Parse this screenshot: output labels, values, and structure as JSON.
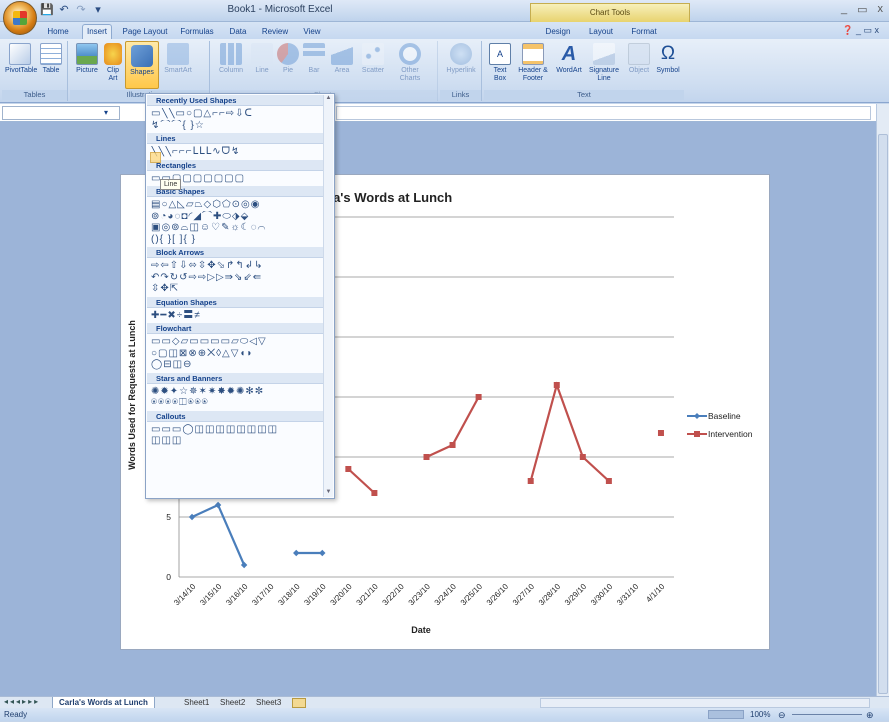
{
  "window": {
    "title": "Book1 - Microsoft Excel",
    "context_tab_header": "Chart Tools",
    "controls": [
      "_",
      "▭",
      "x"
    ]
  },
  "tabs": [
    "Home",
    "Insert",
    "Page Layout",
    "Formulas",
    "Data",
    "Review",
    "View",
    "Design",
    "Layout",
    "Format"
  ],
  "active_tab": "Insert",
  "ribbon": {
    "groups": {
      "tables": "Tables",
      "illustrations": "Illustrati",
      "charts": "Charts",
      "links": "Links",
      "text": "Text"
    },
    "buttons": {
      "pivottable": "PivotTable",
      "table": "Table",
      "picture": "Picture",
      "clipart": "Clip Art",
      "shapes": "Shapes",
      "smartart": "SmartArt",
      "column": "Column",
      "line": "Line",
      "pie": "Pie",
      "bar": "Bar",
      "area": "Area",
      "scatter": "Scatter",
      "other_charts": "Other Charts",
      "hyperlink": "Hyperlink",
      "textbox": "Text Box",
      "header_footer": "Header & Footer",
      "wordart": "WordArt",
      "signature_line": "Signature Line",
      "object": "Object",
      "symbol": "Symbol"
    },
    "selected_button": "Shapes"
  },
  "shapes_gallery": {
    "categories": [
      {
        "name": "Recently Used Shapes",
        "rows": [
          "▭╲╲▭○▢△⌐⌐⇨⇩ᑕ",
          "↯⌒⌒{ }☆"
        ]
      },
      {
        "name": "Lines",
        "rows": [
          "╲╲╲⌐⌐⌐ᒪᒪᒪ∿ᗜ↯"
        ]
      },
      {
        "name": "Rectangles",
        "rows": [
          "▭▭▢▢▢▢▢▢▢"
        ]
      },
      {
        "name": "Basic Shapes",
        "rows": [
          "▤○△◺▱⏢◇⬡⬠⊙◎◉",
          "⊚◔◕◌◘◜◢⌒✚⬭⬗⬙",
          "▣◎⊚⌓◫☺♡✎☼☾◌⌒",
          "(){ }[ ]{ }"
        ]
      },
      {
        "name": "Block Arrows",
        "rows": [
          "⇨⇦⇧⇩⬄⇳✥⬂↱↰↲↳",
          "↶↷↻↺⇨⇨▷▷⇛⇘⇙⇚",
          "⇳✥⇱"
        ]
      },
      {
        "name": "Equation Shapes",
        "rows": [
          "✚━✖÷〓≠"
        ]
      },
      {
        "name": "Flowchart",
        "rows": [
          "▭▭◇▱▭▭▭▭▱⬭◁▽",
          "○▢◫⊠⊗⊕⨉◊△▽◖◗",
          "◯⊟◫⊖"
        ]
      },
      {
        "name": "Stars and Banners",
        "rows": [
          "✺✹✦☆✵✶✷✸✹✺✻✼",
          "⍟⍟⍟⍟◫⍟⍟⍟"
        ]
      },
      {
        "name": "Callouts",
        "rows": [
          "▭▭▭◯◫◫◫◫◫◫◫◫",
          "◫◫◫"
        ]
      }
    ]
  },
  "tooltip": "Line",
  "chart": {
    "title": "Carla's Words at Lunch",
    "xlabel": "Date",
    "ylabel": "Words Used for Requests at Lunch"
  },
  "chart_data": {
    "type": "line",
    "title": "Carla's Words at Lunch",
    "xlabel": "Date",
    "ylabel": "Words Used for Requests at Lunch",
    "categories": [
      "3/14/10",
      "3/15/10",
      "3/16/10",
      "3/17/10",
      "3/18/10",
      "3/19/10",
      "3/20/10",
      "3/21/10",
      "3/22/10",
      "3/23/10",
      "3/24/10",
      "3/25/10",
      "3/26/10",
      "3/27/10",
      "3/28/10",
      "3/29/10",
      "3/30/10",
      "3/31/10",
      "4/1/10"
    ],
    "ylim": [
      0,
      30
    ],
    "yticks": [
      0,
      5,
      10,
      15,
      20,
      25,
      30
    ],
    "grid": true,
    "legend": "right",
    "series": [
      {
        "name": "Baseline",
        "color": "#4a7ebb",
        "values": [
          5,
          6,
          1,
          null,
          2,
          2,
          null,
          null,
          null,
          null,
          null,
          null,
          null,
          null,
          null,
          null,
          null,
          null,
          null
        ]
      },
      {
        "name": "Intervention",
        "color": "#c0504d",
        "values": [
          null,
          null,
          null,
          null,
          null,
          null,
          9,
          7,
          null,
          10,
          11,
          15,
          null,
          8,
          16,
          10,
          8,
          null,
          12
        ]
      }
    ]
  },
  "sheet_tabs": [
    "Carla's Words at Lunch",
    "Sheet1",
    "Sheet2",
    "Sheet3"
  ],
  "active_sheet": "Carla's Words at Lunch",
  "status": {
    "text": "Ready",
    "zoom": "100%"
  }
}
